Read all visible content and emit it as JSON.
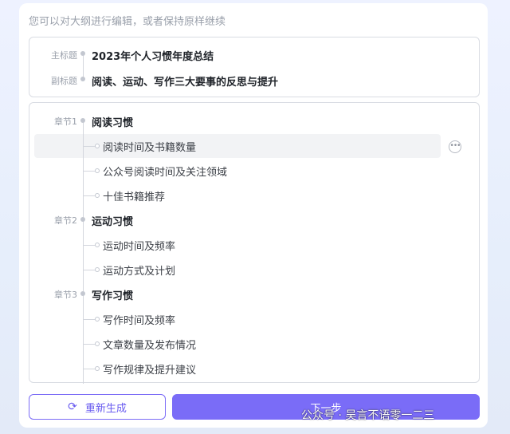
{
  "hint": "您可以对大纲进行编辑，或者保持原样继续",
  "titles": {
    "main_label": "主标题",
    "main_value": "2023年个人习惯年度总结",
    "sub_label": "副标题",
    "sub_value": "阅读、运动、写作三大要事的反思与提升"
  },
  "outline": {
    "chapters": [
      {
        "label": "章节1",
        "title": "阅读习惯",
        "items": [
          "阅读时间及书籍数量",
          "公众号阅读时间及关注领域",
          "十佳书籍推荐"
        ]
      },
      {
        "label": "章节2",
        "title": "运动习惯",
        "items": [
          "运动时间及频率",
          "运动方式及计划"
        ]
      },
      {
        "label": "章节3",
        "title": "写作习惯",
        "items": [
          "写作时间及频率",
          "文章数量及发布情况",
          "写作规律及提升建议"
        ]
      }
    ],
    "more_icon": "more-horizontal-icon"
  },
  "buttons": {
    "regenerate": "重新生成",
    "regenerate_icon": "refresh-icon",
    "next": "下一步"
  },
  "watermark": "公众号 · 吴言不语零一二三",
  "colors": {
    "accent": "#7a6cf7",
    "accent_text": "#6a5cf0"
  }
}
